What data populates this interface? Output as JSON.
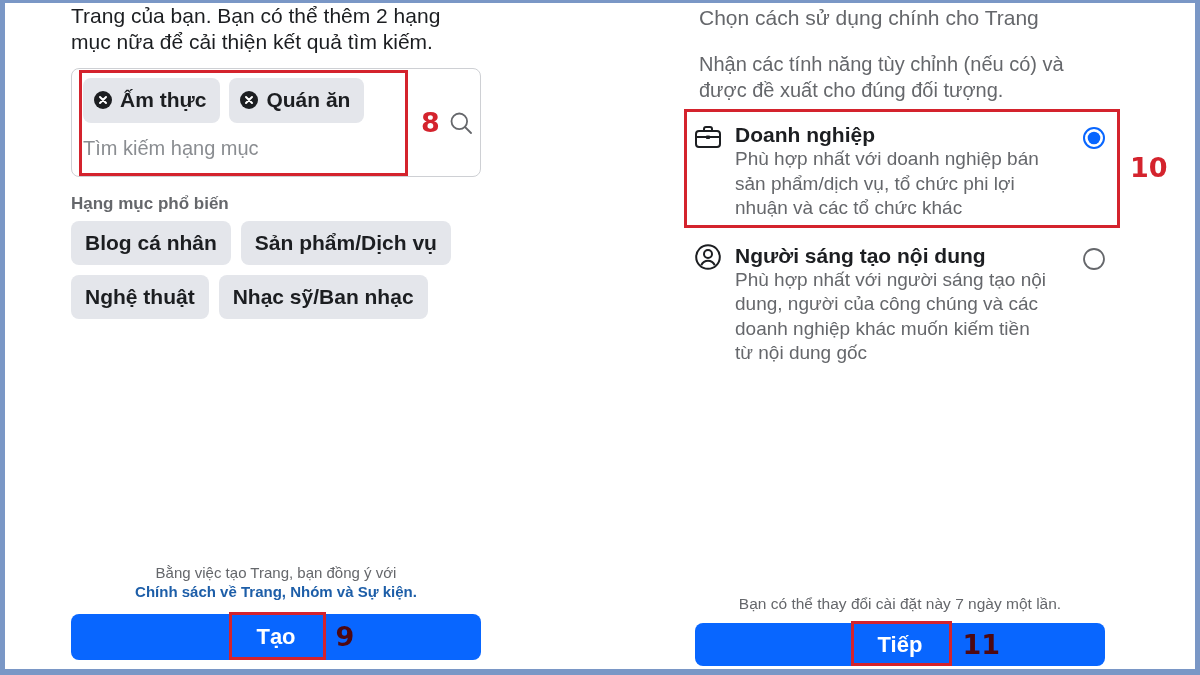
{
  "left_screen": {
    "intro_text": "Trang của bạn. Bạn có thể thêm 2 hạng\nmục nữa để cải thiện kết quả tìm kiếm.",
    "search_field": {
      "tags": [
        {
          "label": "Ấm thực"
        },
        {
          "label": "Quán ăn"
        }
      ],
      "placeholder": "Tìm kiếm hạng mục",
      "callout": "8"
    },
    "popular_label": "Hạng mục phổ biến",
    "popular_categories": [
      "Blog cá nhân",
      "Sản phẩm/Dịch vụ",
      "Nghệ thuật",
      "Nhạc sỹ/Ban nhạc"
    ],
    "terms": {
      "text": "Bằng việc tạo Trang, bạn đồng ý với ",
      "link": "Chính sách về Trang, Nhóm và Sự kiện."
    },
    "primary_button": {
      "label": "Tạo",
      "callout": "9"
    }
  },
  "right_screen": {
    "title": "Chọn cách sử dụng chính cho Trang",
    "subtitle": "Nhận các tính năng tùy chỉnh (nếu có) và\nđược đề xuất cho đúng đối tượng.",
    "options": [
      {
        "kind": "business",
        "title": "Doanh nghiệp",
        "description": "Phù hợp nhất với doanh nghiệp bán\nsản phẩm/dịch vụ, tổ chức phi lợi\nnhuận và các tổ chức khác",
        "selected": true,
        "callout": "10"
      },
      {
        "kind": "creator",
        "title": "Người sáng tạo nội dung",
        "description": "Phù hợp nhất với người sáng tạo nội\ndung, người của công chúng và các\ndoanh nghiệp khác muốn kiếm tiền\ntừ nội dung gốc",
        "selected": false
      }
    ],
    "note": "Bạn có thể thay đổi cài đặt này 7 ngày một lần.",
    "primary_button": {
      "label": "Tiếp",
      "callout": "11"
    }
  }
}
